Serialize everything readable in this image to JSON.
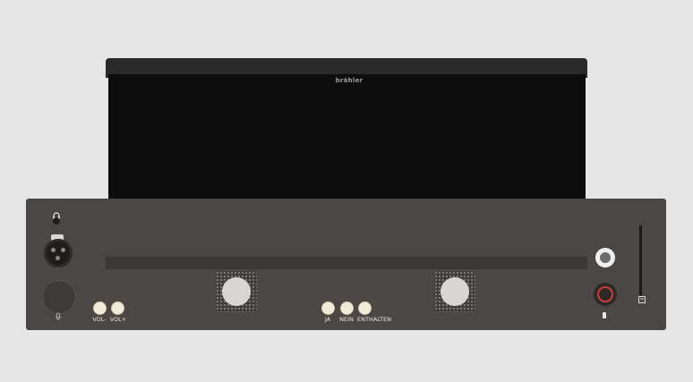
{
  "device": {
    "brand": "brähler",
    "buttons": {
      "vol_minus": "VOL-",
      "vol_plus": "VOL+",
      "yes": "JA",
      "no": "NEIN",
      "abstain": "ENTHALTEN"
    },
    "colors": {
      "panel": "#4a4745",
      "screen": "#0d0d0d",
      "button": "#f1ecd8",
      "record_ring": "#d43a3a"
    }
  }
}
